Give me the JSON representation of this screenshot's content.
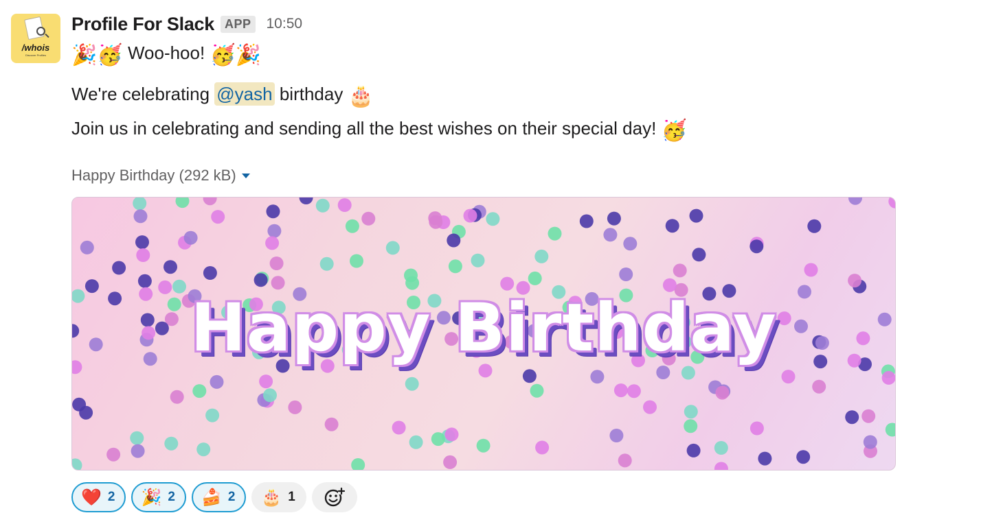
{
  "message": {
    "sender": "Profile For Slack",
    "badge": "APP",
    "time": "10:50",
    "avatar": {
      "title": "/whois",
      "subtitle": "Discover Profiles"
    },
    "line1": {
      "emoji_left": "🎉🥳",
      "text": "Woo-hoo!",
      "emoji_right": "🥳🎉"
    },
    "line2": {
      "prefix": "We're celebrating",
      "mention": "@yash",
      "suffix": "birthday",
      "emoji": "🎂"
    },
    "line3": {
      "text": "Join us in celebrating and sending all the best wishes on their special day!",
      "emoji": "🥳"
    }
  },
  "attachment": {
    "title": "Happy Birthday (292 kB)",
    "banner_text": "Happy Birthday",
    "colors": [
      "#e07ee6",
      "#9d7dd6",
      "#4b3aa8",
      "#7fd8c8",
      "#6fe0a8",
      "#d97fd2"
    ]
  },
  "reactions": [
    {
      "emoji": "❤️",
      "count": "2",
      "active": true,
      "icon": "heart-icon"
    },
    {
      "emoji": "🎉",
      "count": "2",
      "active": true,
      "icon": "party-popper-icon"
    },
    {
      "emoji": "🍰",
      "count": "2",
      "active": true,
      "icon": "cake-slice-icon"
    },
    {
      "emoji": "🎂",
      "count": "1",
      "active": false,
      "icon": "birthday-cake-icon"
    }
  ],
  "add_reaction_icon": "add-reaction-icon"
}
